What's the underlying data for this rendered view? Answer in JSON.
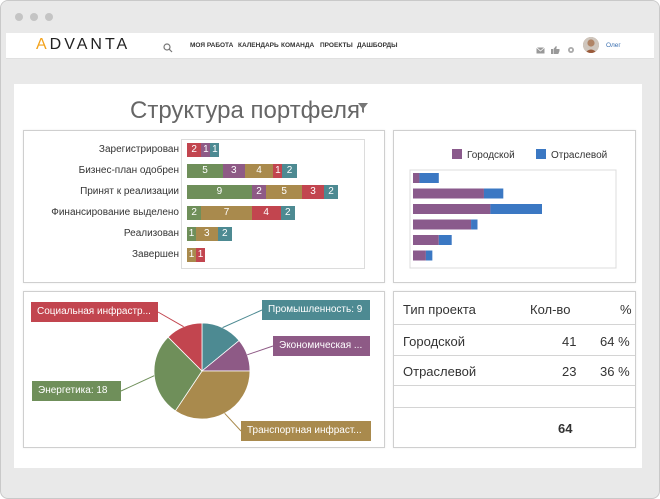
{
  "window": {
    "dots": [
      "red",
      "yellow",
      "green"
    ]
  },
  "app": {
    "logo": "ADVANTA",
    "nav": [
      "МОЯ РАБОТА",
      "КАЛЕНДАРЬ",
      "КОМАНДА",
      "ПРОЕКТЫ",
      "ДАШБОРДЫ"
    ],
    "icons": [
      "search-icon",
      "mail-icon",
      "thumbs-up-icon",
      "settings-icon"
    ],
    "user": "Олег"
  },
  "page": {
    "title": "Структура портфеля"
  },
  "stacked": {
    "colors": [
      "#c2454f",
      "#8e5a86",
      "#6f8f5a",
      "#a98a4d",
      "#c2454f",
      "#4d8a92"
    ],
    "rows": [
      {
        "label": "Зарегистрирован",
        "segs": [
          {
            "v": 2,
            "c": "#c2454f"
          },
          {
            "v": 1,
            "c": "#8e5a86"
          },
          {
            "v": 1,
            "c": "#4d8a92"
          }
        ]
      },
      {
        "label": "Бизнес-план одобрен",
        "segs": [
          {
            "v": 5,
            "c": "#6f8f5a"
          },
          {
            "v": 3,
            "c": "#8e5a86"
          },
          {
            "v": 4,
            "c": "#a98a4d"
          },
          {
            "v": 1,
            "c": "#c2454f"
          },
          {
            "v": 2,
            "c": "#4d8a92"
          }
        ]
      },
      {
        "label": "Принят к реализации",
        "segs": [
          {
            "v": 9,
            "c": "#6f8f5a"
          },
          {
            "v": 2,
            "c": "#8e5a86"
          },
          {
            "v": 5,
            "c": "#a98a4d"
          },
          {
            "v": 3,
            "c": "#c2454f"
          },
          {
            "v": 2,
            "c": "#4d8a92"
          }
        ]
      },
      {
        "label": "Финансирование выделено",
        "segs": [
          {
            "v": 2,
            "c": "#6f8f5a"
          },
          {
            "v": 7,
            "c": "#a98a4d"
          },
          {
            "v": 4,
            "c": "#c2454f"
          },
          {
            "v": 2,
            "c": "#4d8a92"
          }
        ]
      },
      {
        "label": "Реализован",
        "segs": [
          {
            "v": 1,
            "c": "#6f8f5a"
          },
          {
            "v": 3,
            "c": "#a98a4d"
          },
          {
            "v": 2,
            "c": "#4d8a92"
          }
        ]
      },
      {
        "label": "Завершен",
        "segs": [
          {
            "v": 1,
            "c": "#a98a4d"
          },
          {
            "v": 1,
            "c": "#c2454f"
          }
        ]
      }
    ]
  },
  "chart_data": [
    {
      "type": "bar",
      "orientation": "horizontal",
      "stacked": true,
      "categories": [
        "Зарегистрирован",
        "Бизнес-план одобрен",
        "Принят к реализации",
        "Финансирование выделено",
        "Реализован",
        "Завершен"
      ],
      "series": [],
      "segment_values": [
        [
          2,
          1,
          1
        ],
        [
          5,
          3,
          4,
          1,
          2
        ],
        [
          9,
          2,
          5,
          3,
          2
        ],
        [
          2,
          7,
          4,
          2
        ],
        [
          1,
          3,
          2
        ],
        [
          1,
          1
        ]
      ]
    },
    {
      "type": "bar",
      "orientation": "horizontal",
      "stacked": true,
      "legend": "top",
      "series": [
        {
          "name": "Городской",
          "color": "#8a5a8c",
          "values": [
            1,
            11,
            12,
            9,
            4,
            2
          ]
        },
        {
          "name": "Отраслевой",
          "color": "#3b78c3",
          "values": [
            3,
            3,
            8,
            1,
            2,
            1
          ]
        }
      ],
      "xlim": [
        0,
        25
      ]
    },
    {
      "type": "pie",
      "slices": [
        {
          "label": "Промышленность: 9",
          "value": 9,
          "color": "#4d8a92"
        },
        {
          "label": "Экономическая ...",
          "value": 7,
          "color": "#8e5a86"
        },
        {
          "label": "Транспортная инфраст...",
          "value": 22,
          "color": "#a98a4d"
        },
        {
          "label": "Энергетика: 18",
          "value": 18,
          "color": "#6f8f5a"
        },
        {
          "label": "Социальная инфрастр...",
          "value": 8,
          "color": "#c2454f"
        }
      ]
    }
  ],
  "table": {
    "headers": [
      "Тип проекта",
      "Кол-во",
      "%"
    ],
    "rows": [
      [
        "Городской",
        "41",
        "64 %"
      ],
      [
        "Отраслевой",
        "23",
        "36 %"
      ]
    ],
    "total": "64"
  }
}
